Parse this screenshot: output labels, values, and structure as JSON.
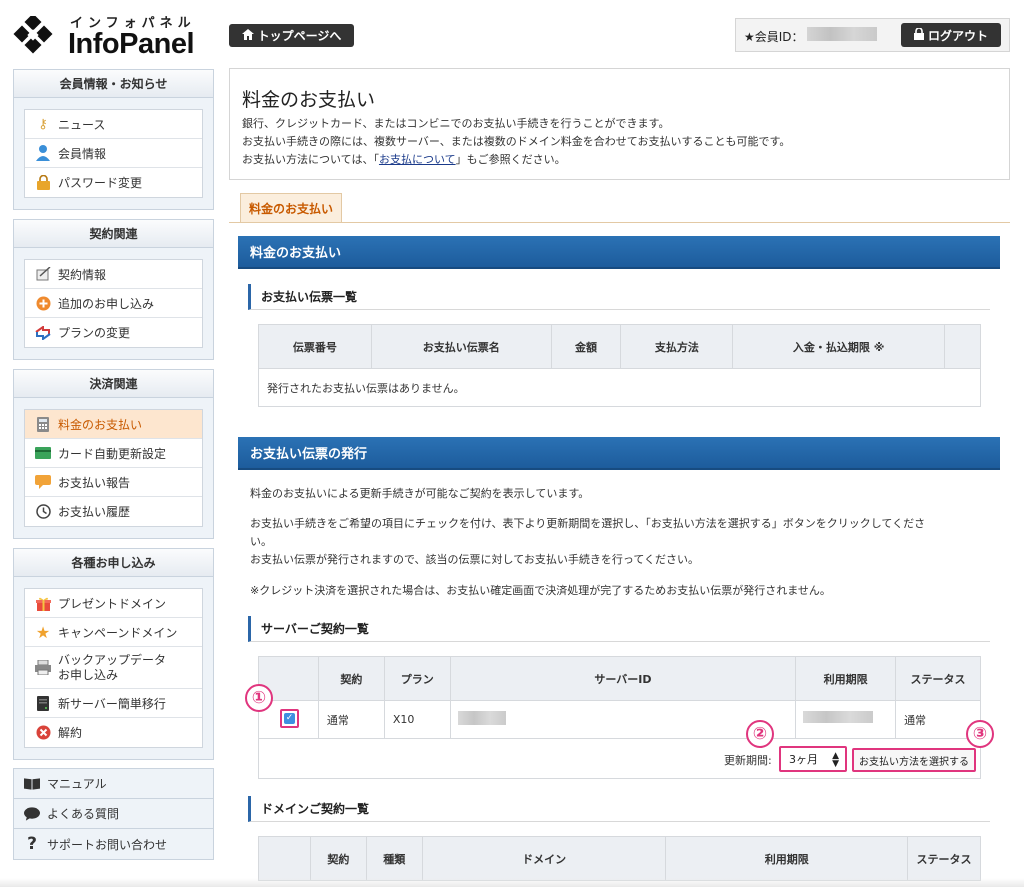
{
  "brand": {
    "kana": "インフォパネル",
    "name": "InfoPanel"
  },
  "header": {
    "top_button": "トップページへ",
    "member_label": "★会員ID：",
    "logout": "ログアウト"
  },
  "sidebar": {
    "groups": [
      {
        "title": "会員情報・お知らせ",
        "items": [
          "ニュース",
          "会員情報",
          "パスワード変更"
        ]
      },
      {
        "title": "契約関連",
        "items": [
          "契約情報",
          "追加のお申し込み",
          "プランの変更"
        ]
      },
      {
        "title": "決済関連",
        "items": [
          "料金のお支払い",
          "カード自動更新設定",
          "お支払い報告",
          "お支払い履歴"
        ]
      },
      {
        "title": "各種お申し込み",
        "items": [
          "プレゼントドメイン",
          "キャンペーンドメイン",
          "バックアップデータ",
          "お申し込み",
          "新サーバー簡単移行",
          "解約"
        ]
      }
    ],
    "links": [
      "マニュアル",
      "よくある質問",
      "サポートお問い合わせ"
    ]
  },
  "intro": {
    "title": "料金のお支払い",
    "line1": "銀行、クレジットカード、またはコンビニでのお支払い手続きを行うことができます。",
    "line2": "お支払い手続きの際には、複数サーバー、または複数のドメイン料金を合わせてお支払いすることも可能です。",
    "line3_pre": "お支払い方法については、「",
    "line3_link": "お支払について",
    "line3_post": "」もご参照ください。"
  },
  "tab": "料金のお支払い",
  "section1": {
    "bar": "料金のお支払い",
    "sub": "お支払い伝票一覧",
    "headers": [
      "伝票番号",
      "お支払い伝票名",
      "金額",
      "支払方法",
      "入金・払込期限 ※"
    ],
    "empty": "発行されたお支払い伝票はありません。"
  },
  "section2": {
    "bar": "お支払い伝票の発行",
    "p1": "料金のお支払いによる更新手続きが可能なご契約を表示しています。",
    "p2a": "お支払い手続きをご希望の項目にチェックを付け、表下より更新期間を選択し、「お支払い方法を選択する」ボタンをクリックしてくださ",
    "p2b": "い。",
    "p3": "お支払い伝票が発行されますので、該当の伝票に対してお支払い手続きを行ってください。",
    "p4": "※クレジット決済を選択された場合は、お支払い確定画面で決済処理が完了するためお支払い伝票が発行されません。",
    "server_sub": "サーバーご契約一覧",
    "server_headers": [
      "契約",
      "プラン",
      "サーバーID",
      "利用期限",
      "ステータス"
    ],
    "server_row": {
      "contract": "通常",
      "plan": "X10",
      "status": "通常"
    },
    "period_label": "更新期間:",
    "period_value": "3ヶ月",
    "pay_button": "お支払い方法を選択する",
    "domain_sub": "ドメインご契約一覧",
    "domain_headers": [
      "契約",
      "種類",
      "ドメイン",
      "利用期限",
      "ステータス"
    ]
  },
  "badges": [
    "①",
    "②",
    "③"
  ],
  "colors": {
    "accent": "#2b66a8",
    "highlight": "#e0357e",
    "active": "#c85a00"
  }
}
